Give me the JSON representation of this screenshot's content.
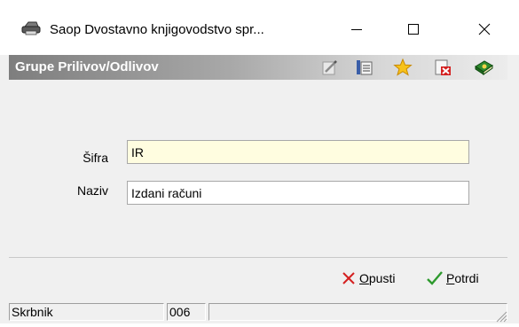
{
  "window": {
    "title": "Saop Dvostavno knjigovodstvo spr...",
    "icon": "printer-icon",
    "controls": [
      "minimize-icon",
      "maximize-icon",
      "close-icon"
    ]
  },
  "header": {
    "title": "Grupe Prilivov/Odlivov",
    "toolbar_icons": [
      "edit-icon",
      "list-icon",
      "star-icon",
      "delete-icon",
      "book-icon"
    ]
  },
  "form": {
    "sifra_label": "Šifra",
    "sifra_value": "IR",
    "naziv_label": "Naziv",
    "naziv_value": "Izdani računi"
  },
  "buttons": {
    "cancel_label_ul": "O",
    "cancel_label_rest": "pusti",
    "confirm_label_ul": "P",
    "confirm_label_rest": "otrdi"
  },
  "statusbar": {
    "user": "Skrbnik",
    "code": "006",
    "extra": ""
  },
  "colors": {
    "header_gradient_start": "#7e7e7e",
    "field_highlight": "#fffde0",
    "cancel_red": "#d42020",
    "confirm_green": "#2e9a2e"
  }
}
